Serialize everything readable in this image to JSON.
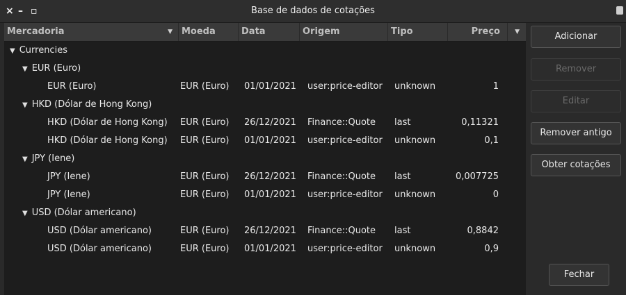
{
  "window": {
    "title": "Base de dados de cotações",
    "close_glyph": "×",
    "minimize_glyph": "–",
    "maximize_glyph": "▫"
  },
  "table": {
    "headers": {
      "commodity": "Mercadoria",
      "currency": "Moeda",
      "date": "Data",
      "source": "Origem",
      "type": "Tipo",
      "price": "Preço"
    },
    "group_root": "Currencies",
    "groups": {
      "eur": "EUR (Euro)",
      "hkd": "HKD (Dólar de Hong Kong)",
      "jpy": "JPY (Iene)",
      "usd": "USD (Dólar americano)"
    },
    "rows": [
      {
        "commodity": "EUR (Euro)",
        "currency": "EUR (Euro)",
        "date": "01/01/2021",
        "source": "user:price-editor",
        "type": "unknown",
        "price": "1"
      },
      {
        "commodity": "HKD (Dólar de Hong Kong)",
        "currency": "EUR (Euro)",
        "date": "26/12/2021",
        "source": "Finance::Quote",
        "type": "last",
        "price": "0,11321"
      },
      {
        "commodity": "HKD (Dólar de Hong Kong)",
        "currency": "EUR (Euro)",
        "date": "01/01/2021",
        "source": "user:price-editor",
        "type": "unknown",
        "price": "0,1"
      },
      {
        "commodity": "JPY (Iene)",
        "currency": "EUR (Euro)",
        "date": "26/12/2021",
        "source": "Finance::Quote",
        "type": "last",
        "price": "0,007725"
      },
      {
        "commodity": "JPY (Iene)",
        "currency": "EUR (Euro)",
        "date": "01/01/2021",
        "source": "user:price-editor",
        "type": "unknown",
        "price": "0"
      },
      {
        "commodity": "USD (Dólar americano)",
        "currency": "EUR (Euro)",
        "date": "26/12/2021",
        "source": "Finance::Quote",
        "type": "last",
        "price": "0,8842"
      },
      {
        "commodity": "USD (Dólar americano)",
        "currency": "EUR (Euro)",
        "date": "01/01/2021",
        "source": "user:price-editor",
        "type": "unknown",
        "price": "0,9"
      }
    ]
  },
  "buttons": {
    "add": "Adicionar",
    "remove": "Remover",
    "edit": "Editar",
    "remove_old": "Remover antigo",
    "get_quotes": "Obter cotações",
    "close": "Fechar"
  }
}
